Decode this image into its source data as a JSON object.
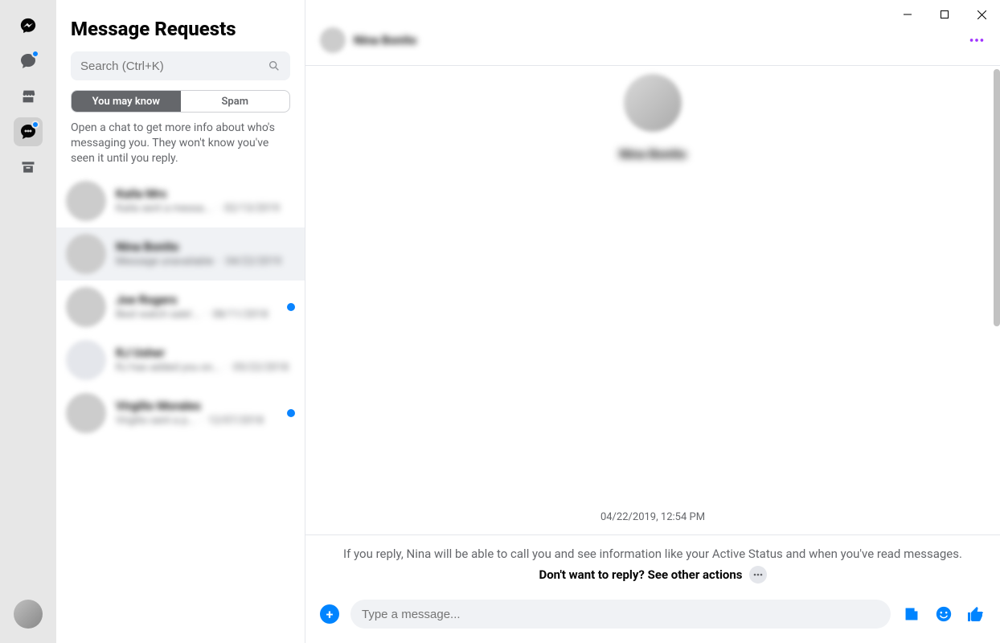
{
  "rail": {
    "icons": [
      "messenger-logo",
      "chats",
      "marketplace",
      "message-requests",
      "archive"
    ]
  },
  "sidebar": {
    "title": "Message Requests",
    "search_placeholder": "Search (Ctrl+K)",
    "segments": {
      "you_may_know": "You may know",
      "spam": "Spam"
    },
    "info": "Open a chat to get more info about who's messaging you. They won't know you've seen it until you reply.",
    "items": [
      {
        "name": "Kaila Mrs",
        "snippet": "Kaila sent a messa...",
        "date": "02/13/2019",
        "unread": false
      },
      {
        "name": "Nina Bonito",
        "snippet": "Message unavailable",
        "date": "04/22/2019",
        "unread": false,
        "selected": true
      },
      {
        "name": "Joe Rogers",
        "snippet": "Best watch sale!...",
        "date": "08/11/2018",
        "unread": true
      },
      {
        "name": "RJ Usher",
        "snippet": "RJ has added you on...",
        "date": "05/22/2018",
        "unread": false
      },
      {
        "name": "Virgilio Morales",
        "snippet": "Virgilio sent a p...",
        "date": "12/07/2018",
        "unread": true
      }
    ]
  },
  "conversation": {
    "header_name": "Nina Bonito",
    "big_name": "Nina Bonito",
    "timestamp": "04/22/2019, 12:54 PM",
    "privacy_text": "If you reply, Nina will be able to call you and see information like your Active Status and when you've read messages.",
    "actions_text": "Don't want to reply? See other actions",
    "composer_placeholder": "Type a message..."
  },
  "colors": {
    "accent": "#0084ff",
    "purple": "#a033ff"
  }
}
